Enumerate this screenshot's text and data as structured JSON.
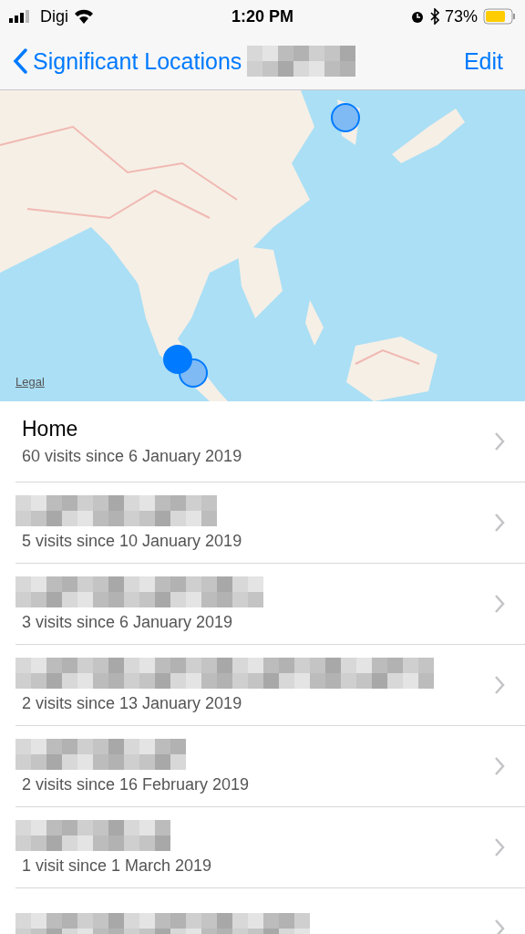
{
  "status_bar": {
    "carrier": "Digi",
    "time": "1:20 PM",
    "battery": "73%"
  },
  "nav": {
    "back": "Significant Locations",
    "action": "Edit"
  },
  "map": {
    "legal": "Legal"
  },
  "locations": [
    {
      "kind": "named",
      "title": "Home",
      "subtitle": "60 visits since 6 January 2019"
    },
    {
      "kind": "redacted",
      "subtitle": "5 visits since 10 January 2019"
    },
    {
      "kind": "redacted",
      "subtitle": "3 visits since 6 January 2019"
    },
    {
      "kind": "redacted",
      "subtitle": "2 visits since 13 January 2019"
    },
    {
      "kind": "redacted",
      "subtitle": "2 visits since 16 February 2019"
    },
    {
      "kind": "redacted",
      "subtitle": "1 visit since 1 March 2019"
    },
    {
      "kind": "redacted"
    }
  ]
}
